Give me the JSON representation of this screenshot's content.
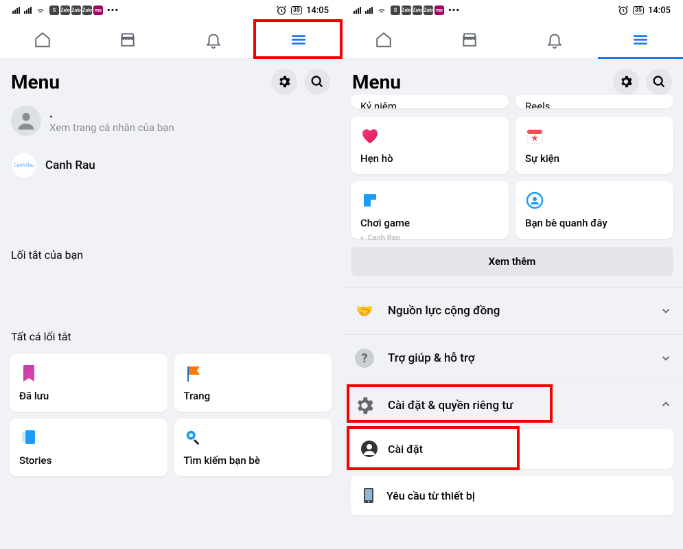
{
  "status": {
    "time": "14:05",
    "battery": "35"
  },
  "menu_title": "Menu",
  "left": {
    "profile_sub": "Xem trang cá nhân của bạn",
    "profile_dot": ".",
    "page_name": "Canh Rau",
    "shortcuts_label": "Lối tắt của bạn",
    "all_shortcuts_label": "Tất cá lối tắt",
    "cards": {
      "saved": "Đã lưu",
      "pages": "Trang",
      "stories": "Stories",
      "find_friends": "Tìm kiếm bạn bè"
    }
  },
  "right": {
    "partial1": "Kỷ niệm",
    "partial2": "Reels",
    "cards": {
      "dating": "Hẹn hò",
      "events": "Sự kiện",
      "gaming": "Chơi game",
      "nearby": "Bạn bè quanh đây"
    },
    "see_more": "Xem thêm",
    "watermark": "Canh Rau",
    "exp": {
      "community": "Nguồn lực cộng đồng",
      "help": "Trợ giúp & hỗ trợ",
      "settings_privacy": "Cài đặt & quyền riêng tư",
      "settings": "Cài đặt",
      "device_requests": "Yêu cầu từ thiết bị"
    }
  }
}
